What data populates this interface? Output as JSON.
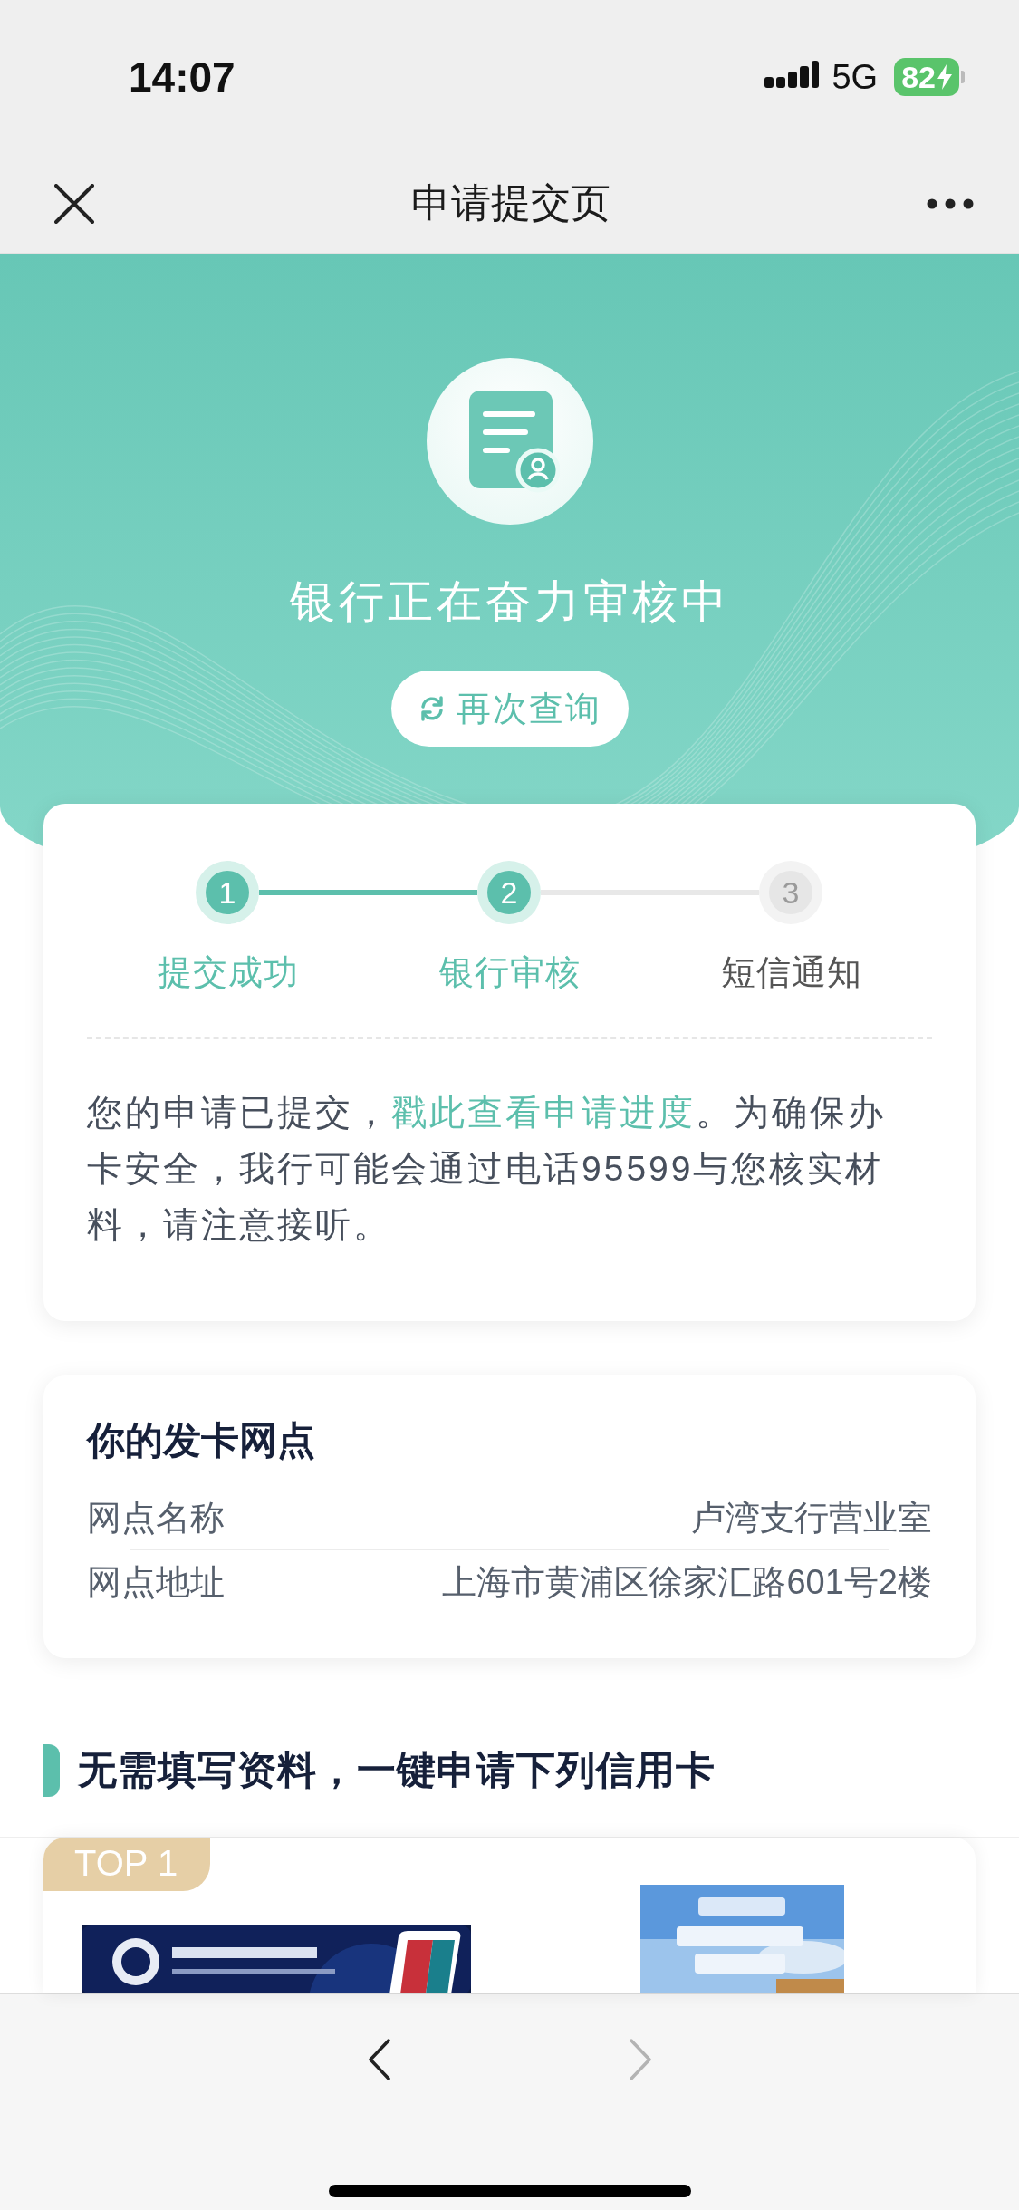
{
  "status_bar": {
    "time": "14:07",
    "network": "5G",
    "battery": "82",
    "charging": true
  },
  "nav": {
    "title": "申请提交页"
  },
  "hero": {
    "title": "银行正在奋力审核中",
    "button": "再次查询"
  },
  "progress": {
    "steps": [
      {
        "number": "1",
        "label": "提交成功",
        "done": true
      },
      {
        "number": "2",
        "label": "银行审核",
        "done": true
      },
      {
        "number": "3",
        "label": "短信通知",
        "done": false
      }
    ],
    "notice": {
      "before": "您的申请已提交，",
      "link": "戳此查看申请进度",
      "after": "。为确保办卡安全，我行可能会通过电话95599与您核实材料，请注意接听。"
    }
  },
  "branch": {
    "title": "你的发卡网点",
    "rows": [
      {
        "label": "网点名称",
        "value": "卢湾支行营业室"
      },
      {
        "label": "网点地址",
        "value": "上海市黄浦区徐家汇路601号2楼"
      }
    ]
  },
  "recommend": {
    "title": "无需填写资料，一键申请下列信用卡",
    "cards": [
      {
        "badge": "TOP 1"
      }
    ]
  },
  "bottom_bar": {
    "buttons": [
      {
        "kind": "back",
        "disabled": false
      },
      {
        "kind": "forward",
        "disabled": true
      }
    ]
  }
}
